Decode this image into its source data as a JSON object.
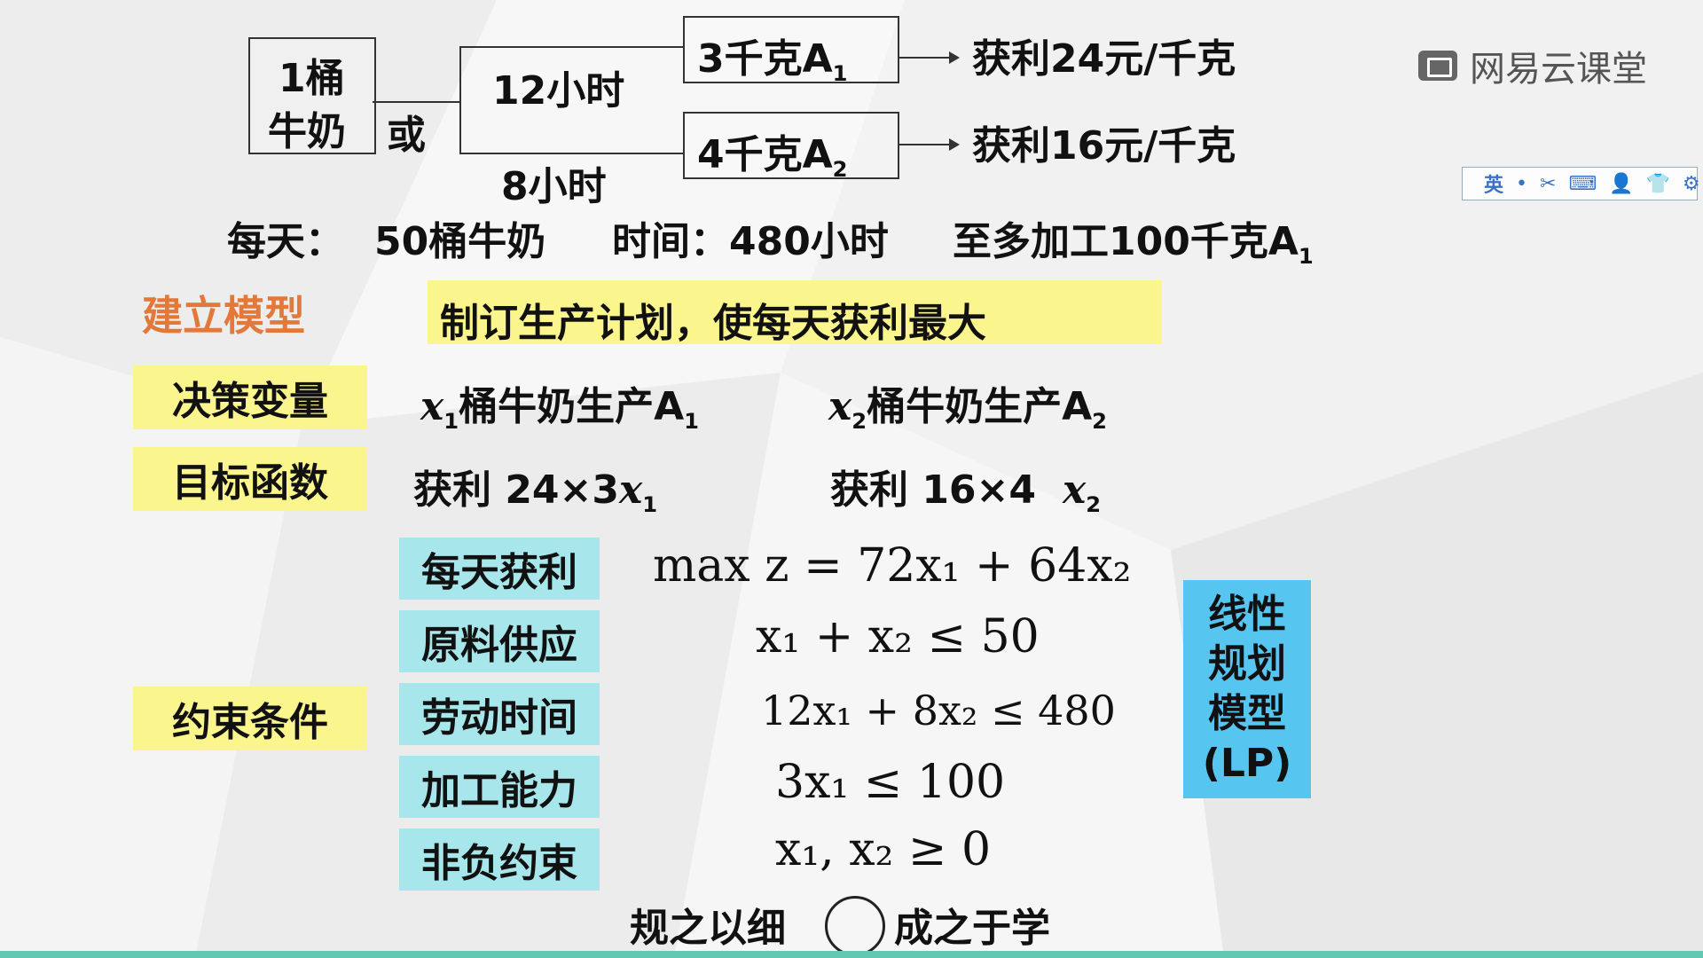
{
  "top_diagram": {
    "left_box": {
      "line1": "1桶",
      "line2": "牛奶"
    },
    "or": "或",
    "branch_top_time": "12小时",
    "branch_bottom_time": "8小时",
    "product_top": {
      "prefix": "3千克A",
      "sub": "1"
    },
    "product_bottom": {
      "prefix": "4千克A",
      "sub": "2"
    },
    "profit_top": "获利24元/千克",
    "profit_bottom": "获利16元/千克"
  },
  "daily": {
    "label": "每天：",
    "milk": "50桶牛奶",
    "time": "时间：480小时",
    "limit_prefix": "至多加工100千克A",
    "limit_sub": "1"
  },
  "model": {
    "title": "建立模型",
    "goal": "制订生产计划，使每天获利最大"
  },
  "decision": {
    "label": "决策变量",
    "x1": "x",
    "x1_sub": "1",
    "x1_text": "桶牛奶生产A",
    "x1_text_sub": "1",
    "x2": "x",
    "x2_sub": "2",
    "x2_text": "桶牛奶生产A",
    "x2_text_sub": "2"
  },
  "objective": {
    "label": "目标函数",
    "profit1": "获利  24×3",
    "profit1_var": "x",
    "profit1_sub": "1",
    "profit2": "获利  16×4",
    "profit2_var": "x",
    "profit2_sub": "2"
  },
  "constraints": {
    "label": "约束条件",
    "rows": [
      {
        "label": "每天获利",
        "expr": "max  z = 72x₁ + 64x₂"
      },
      {
        "label": "原料供应",
        "expr": "x₁ + x₂ ≤ 50"
      },
      {
        "label": "劳动时间",
        "expr": "12x₁ + 8x₂ ≤ 480"
      },
      {
        "label": "加工能力",
        "expr": "3x₁ ≤ 100"
      },
      {
        "label": "非负约束",
        "expr": "x₁, x₂ ≥ 0"
      }
    ]
  },
  "lp_box": {
    "l1": "线性",
    "l2": "规划",
    "l3": "模型",
    "l4": "(LP)"
  },
  "footer": {
    "left": "规之以细",
    "right": "成之于学"
  },
  "brand": {
    "name": "网易云课堂"
  },
  "toolbar": {
    "lang": "英"
  }
}
